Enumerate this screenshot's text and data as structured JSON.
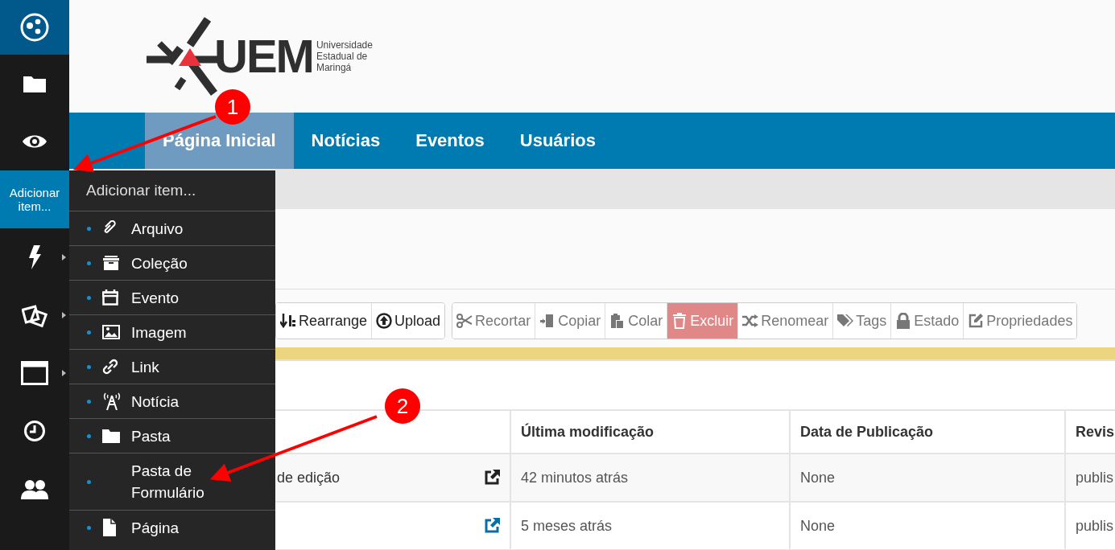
{
  "sidebar": {
    "items": [
      {
        "selected": false,
        "submenu": false
      },
      {
        "selected": false,
        "submenu": false
      },
      {
        "label": "Adicionar item...",
        "selected": true,
        "submenu": false
      },
      {
        "selected": false,
        "submenu": true
      },
      {
        "selected": false,
        "submenu": true
      },
      {
        "selected": false,
        "submenu": true
      },
      {
        "selected": false,
        "submenu": false
      },
      {
        "selected": false,
        "submenu": false
      }
    ]
  },
  "header": {
    "logo_text": "UEM",
    "logo_subtitle": [
      "Universidade",
      "Estadual de",
      "Maringá"
    ]
  },
  "nav": {
    "tabs": [
      {
        "label": "Página Inicial",
        "selected": true
      },
      {
        "label": "Notícias",
        "selected": false
      },
      {
        "label": "Eventos",
        "selected": false
      },
      {
        "label": "Usuários",
        "selected": false
      }
    ]
  },
  "toolbar": {
    "groups": [
      [
        {
          "label": "Rearrange",
          "kind": "sort",
          "disabled": false
        },
        {
          "label": "Upload",
          "kind": "upload",
          "disabled": false
        }
      ],
      [
        {
          "label": "Recortar",
          "kind": "cut",
          "disabled": true
        },
        {
          "label": "Copiar",
          "kind": "copy",
          "disabled": true
        },
        {
          "label": "Colar",
          "kind": "paste",
          "disabled": true
        },
        {
          "label": "Excluir",
          "kind": "delete",
          "disabled": true
        },
        {
          "label": "Renomear",
          "kind": "rename",
          "disabled": true
        },
        {
          "label": "Tags",
          "kind": "tags",
          "disabled": true
        },
        {
          "label": "Estado",
          "kind": "state",
          "disabled": true
        },
        {
          "label": "Propriedades",
          "kind": "props",
          "disabled": true
        }
      ]
    ]
  },
  "table": {
    "columns": [
      "Última modificação",
      "Data de Publicação",
      "Revis"
    ],
    "rows": [
      {
        "title": "de edição",
        "modified": "42 minutos atrás",
        "published": "None",
        "review": "publis"
      },
      {
        "modified": "5 meses atrás",
        "published": "None",
        "review": "publis"
      }
    ]
  },
  "add_menu": {
    "title": "Adicionar item...",
    "items": [
      "Arquivo",
      "Coleção",
      "Evento",
      "Imagem",
      "Link",
      "Notícia",
      "Pasta",
      "Pasta de Formulário",
      "Página"
    ]
  },
  "annotations": [
    "1",
    "2"
  ]
}
